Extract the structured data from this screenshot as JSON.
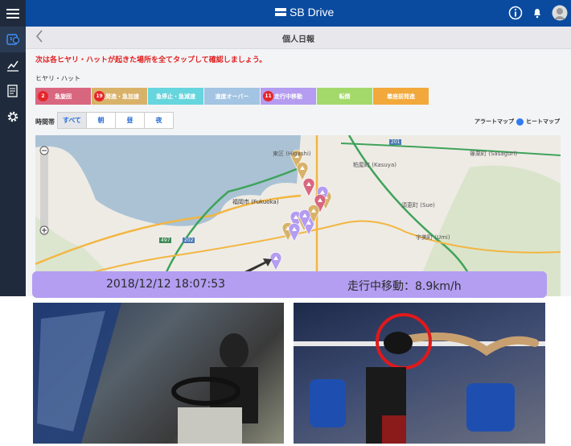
{
  "header": {
    "logo": "SB Drive"
  },
  "subheader": {
    "title": "個人日報",
    "back_icon": "chevron-left-icon"
  },
  "notice": "次は各ヒヤリ・ハットが起きた場所を全てタップして確認しましょう。",
  "hiyari_label": "ヒヤリ・ハット",
  "categories": [
    {
      "label": "急旋回",
      "count": "2",
      "color": "#d9667f"
    },
    {
      "label": "急発進・急加速",
      "count": "19",
      "color": "#d9b26a"
    },
    {
      "label": "急停止・急減速",
      "count": "",
      "color": "#66d5dd"
    },
    {
      "label": "速度オーバー",
      "count": "",
      "color": "#a3c4e2"
    },
    {
      "label": "走行中移動",
      "count": "11",
      "color": "#b49cf0"
    },
    {
      "label": "転倒",
      "count": "",
      "color": "#a3d96a"
    },
    {
      "label": "着座前発進",
      "count": "",
      "color": "#f2a83a"
    }
  ],
  "time_label": "時間帯",
  "times": [
    "すべて",
    "朝",
    "昼",
    "夜"
  ],
  "map_toggle": {
    "left": "アラートマップ",
    "right": "ヒートマップ"
  },
  "map_labels": {
    "higashi": "東区 (Higashi)",
    "fukuoka": "福岡市 (Fukuoka)",
    "kasuya": "粕屋町 (Kasuya)",
    "sue": "須恵町 (Sue)",
    "umi": "宇美町 (Umi)",
    "sasaguri": "篠栗町 (Sasaguri)",
    "r497": "497",
    "r202": "202",
    "r201": "201"
  },
  "overlay": {
    "datetime": "2018/12/12 18:07:53",
    "event": "走行中移動：8.9km/h"
  }
}
